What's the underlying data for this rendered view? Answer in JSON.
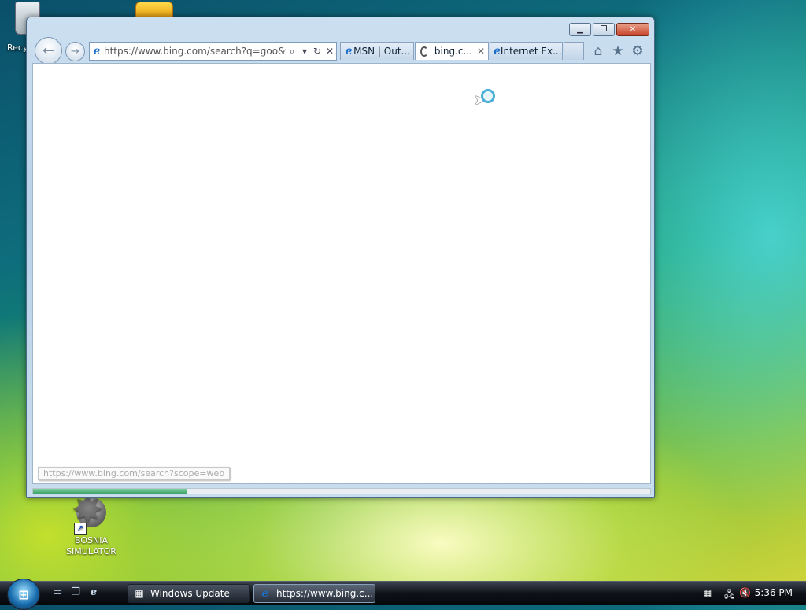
{
  "desktop": {
    "recycle_bin_label": "Recy",
    "shortcut_label_line1": "BOSNIA",
    "shortcut_label_line2": "SIMULATOR"
  },
  "browser": {
    "address": "https://www.bing.com/search?q=goo&fc",
    "tabs": [
      {
        "title": "MSN | Out...",
        "icon": "ie-icon"
      },
      {
        "title": "bing.c...",
        "icon": "loading-spinner-icon",
        "close": "✕"
      },
      {
        "title": "Internet Ex...",
        "icon": "ie-icon"
      }
    ],
    "status_url": "https://www.bing.com/search?scope=web",
    "load_progress_percent": 25
  },
  "taskbar": {
    "items": [
      {
        "label": "Windows Update",
        "icon": "windows-update-icon"
      },
      {
        "label": "https://www.bing.c...",
        "icon": "ie-icon"
      }
    ],
    "clock": "5:36 PM"
  },
  "icons": {
    "ie": "e",
    "search": "⌕",
    "dropdown": "▾",
    "refresh": "↻",
    "stop": "✕",
    "home": "⌂",
    "favorites": "★",
    "tools": "⚙",
    "back": "←",
    "forward": "→"
  }
}
